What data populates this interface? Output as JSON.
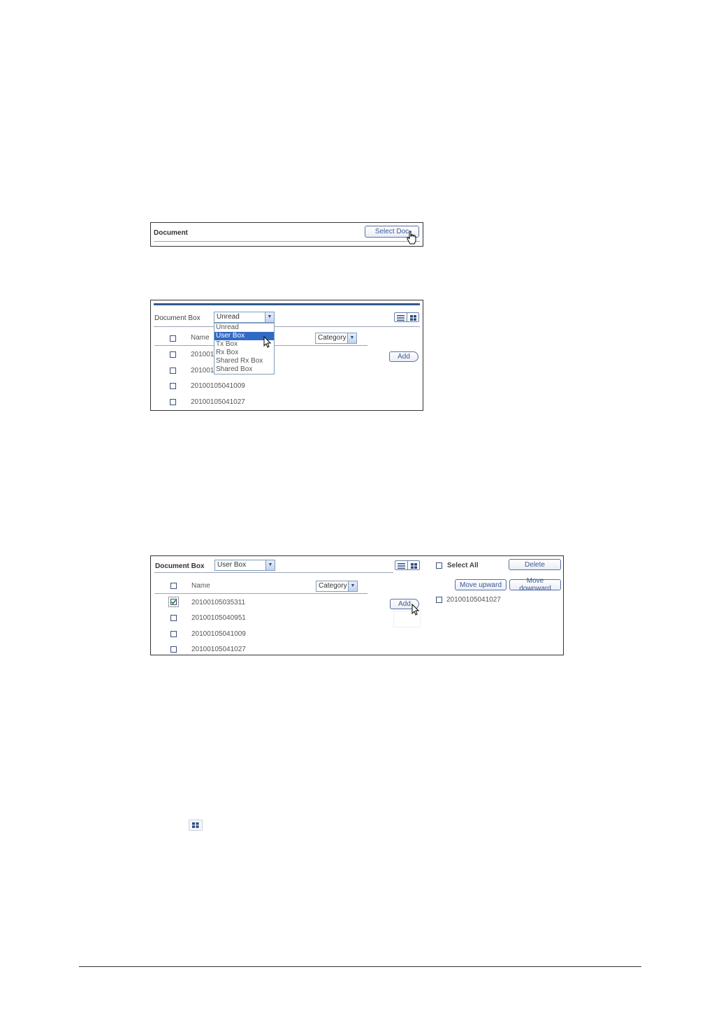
{
  "panel1": {
    "label": "Document",
    "button": "Select Doc"
  },
  "panel2": {
    "label": "Document Box",
    "dropdown_value": "Unread",
    "dropdown_options": [
      "Unread",
      "User Box",
      "Tx Box",
      "Rx Box",
      "Shared Rx Box",
      "Shared Box"
    ],
    "highlighted_option": "User Box",
    "name_header": "Name",
    "category": "Category",
    "add": "Add",
    "rows": [
      "201001",
      "201001",
      "20100105041009",
      "20100105041027"
    ]
  },
  "panel3": {
    "label": "Document Box",
    "dropdown_value": "User Box",
    "select_all": "Select All",
    "delete": "Delete",
    "move_up": "Move upward",
    "move_down": "Move downward",
    "name_header": "Name",
    "category": "Category",
    "add": "Add",
    "rows": [
      "20100105035311",
      "20100105040951",
      "20100105041009",
      "20100105041027"
    ],
    "checked_row": 0,
    "added": [
      "20100105041027"
    ]
  },
  "colors": {
    "accent": "#2e5a8c",
    "highlight": "#316ac5",
    "border": "#333333"
  },
  "icons": [
    "hand-pointer-icon",
    "arrow-cursor-icon",
    "list-view-icon",
    "thumbnail-view-icon",
    "checkmark-icon"
  ]
}
